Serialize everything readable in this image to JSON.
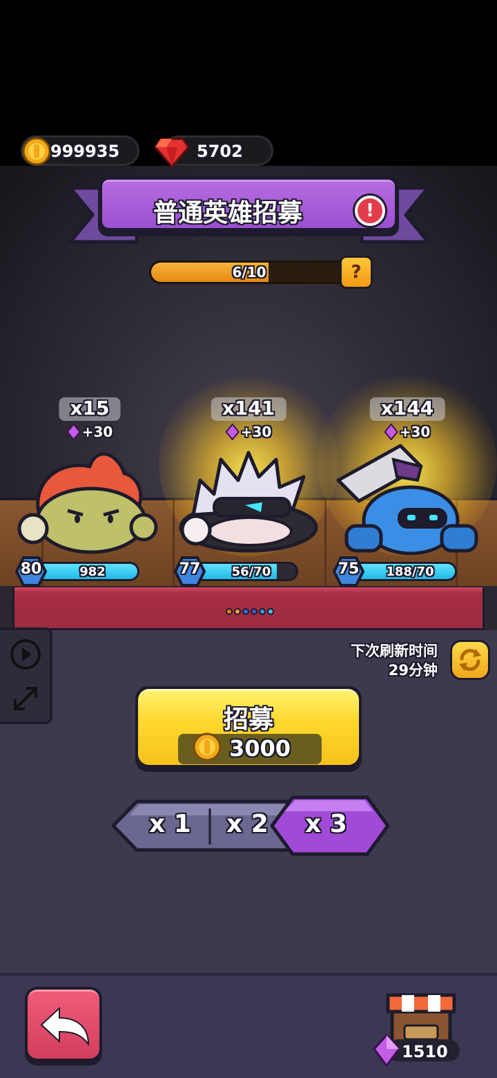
{
  "currency": {
    "coins": "999935",
    "gems": "5702"
  },
  "banner": {
    "title": "普通英雄招募",
    "info_icon": "exclamation-icon"
  },
  "progress": {
    "label": "6/10",
    "fraction": 0.6,
    "help_label": "?"
  },
  "heroes": [
    {
      "count": "x15",
      "bonus": "+30",
      "level": "80",
      "xp_label": "982",
      "xp_fraction": 1.0,
      "highlighted": false
    },
    {
      "count": "x141",
      "bonus": "+30",
      "level": "77",
      "xp_label": "56/70",
      "xp_fraction": 0.8,
      "highlighted": true
    },
    {
      "count": "x144",
      "bonus": "+30",
      "level": "75",
      "xp_label": "188/70",
      "xp_fraction": 1.0,
      "highlighted": true
    }
  ],
  "page_dots": [
    "#f07a1a",
    "#f2a530",
    "#3b6fe0",
    "#4a57d6",
    "#2aa0e8",
    "#37c7e8"
  ],
  "refresh": {
    "line1": "下次刷新时间",
    "line2": "29分钟"
  },
  "recruit": {
    "label": "招募",
    "cost": "3000"
  },
  "multipliers": {
    "options": [
      "x 1",
      "x 2",
      "x 3"
    ],
    "selected": "x 3"
  },
  "shop": {
    "count": "1510"
  },
  "colors": {
    "accent_purple": "#9b4fd2",
    "button_yellow": "#ffd92f",
    "back_red": "#d33e5c",
    "xp_cyan": "#20b8e8"
  }
}
